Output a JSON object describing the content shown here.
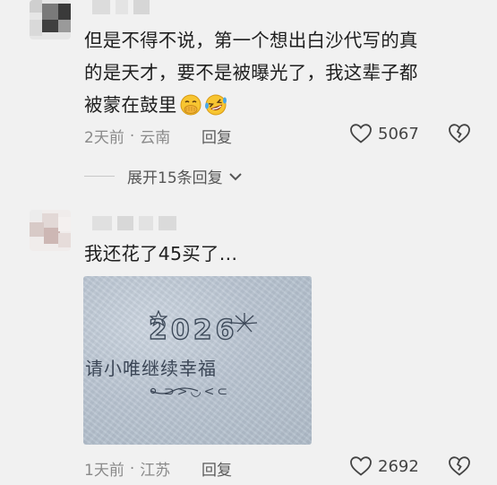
{
  "comments": [
    {
      "text_lines": [
        "但是不得不说，第一个想出白沙代写的真",
        "的是天才，要不是被曝光了，我这辈子都",
        "被蒙在鼓里"
      ],
      "emojis": [
        "face-with-hand-over-mouth-emoji",
        "rolling-on-floor-laughing-emoji"
      ],
      "time": "2天前",
      "location": "云南",
      "separator": "·",
      "reply_label": "回复",
      "like_count": "5067",
      "expand_label": "展开15条回复"
    },
    {
      "text_lines": [
        "我还花了45买了…"
      ],
      "photo": {
        "year_text": "2026",
        "etched_text": "请小唯继续幸福",
        "deco_text": "⊃>◡<⊂"
      },
      "time": "1天前",
      "location": "江苏",
      "separator": "·",
      "reply_label": "回复",
      "like_count": "2692"
    }
  ],
  "icons": {
    "like": "heart-outline-icon",
    "dislike": "broken-heart-icon",
    "expand": "chevron-down-icon"
  },
  "colors": {
    "background": "#f1f1f1",
    "text": "#1f1f1f",
    "meta": "#8a8a8a"
  }
}
